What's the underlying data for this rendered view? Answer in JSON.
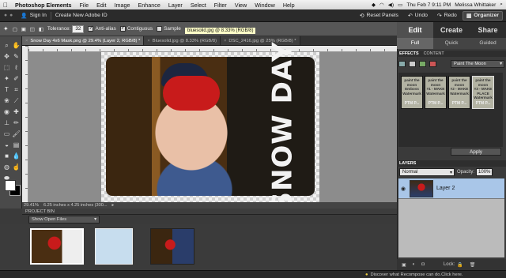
{
  "menubar": {
    "apple": "",
    "items": [
      "Photoshop Elements",
      "File",
      "Edit",
      "Image",
      "Enhance",
      "Layer",
      "Select",
      "Filter",
      "View",
      "Window",
      "Help"
    ],
    "datetime": "Thu Feb 7  9:11 PM",
    "user": "Melissa Whittaker"
  },
  "appbar": {
    "sign_in": "Sign In",
    "create_id": "Create New Adobe ID",
    "reset_panels": "Reset Panels",
    "undo": "Undo",
    "redo": "Redo",
    "organizer": "Organizer"
  },
  "options": {
    "tolerance_label": "Tolerance:",
    "tolerance_value": "32",
    "anti_alias": "Anti-alias",
    "contiguous": "Contiguous",
    "sample": "Sample",
    "tooltip": "bluesolid.jpg @ 8.33% (RGB/8)"
  },
  "doc_tabs": [
    {
      "label": "Snow Day 4x6 Mask.png @ 29.4% (Layer 2, RGB/8) *",
      "active": true
    },
    {
      "label": "Bluesolid.jpg @ 8.33% (RGB/8)",
      "active": false
    },
    {
      "label": "DSC_2416.jpg @ 25% (RGB/8) *",
      "active": false
    }
  ],
  "canvas": {
    "overlay_text": "SNOW DAY"
  },
  "status": {
    "zoom": "29.41%",
    "size": "6.25 inches x 4.25 inches (300..."
  },
  "bin": {
    "title": "PROJECT BIN",
    "select": "Show Open Files"
  },
  "panel": {
    "mode_tabs": [
      "Edit",
      "Create",
      "Share"
    ],
    "sub_tabs": [
      "Full",
      "Quick",
      "Guided"
    ],
    "effects_tab": "EFFECTS",
    "content_tab": "CONTENT",
    "effects_select": "Paint The Moon",
    "effects": [
      {
        "top": "paint the moon",
        "label": "Emboss Watermark",
        "wm": "PTM P..."
      },
      {
        "top": "paint the moon",
        "label": "#1 - MAKE Watermark",
        "wm": "PTM P..."
      },
      {
        "top": "paint the moon",
        "label": "#2 - MAKE Watermark",
        "wm": "PTM P..."
      },
      {
        "top": "paint the moon",
        "label": "#3 - MAKE PLACE Watermark",
        "wm": "PTM P..."
      }
    ],
    "apply": "Apply",
    "layers_title": "LAYERS",
    "blend_mode": "Normal",
    "opacity_label": "Opacity:",
    "opacity_value": "100%",
    "layer_name": "Layer 2",
    "lock_label": "Lock:"
  },
  "bottom": {
    "message": "Discover what Recompose can do.Click here."
  },
  "colors": {
    "accent": "#a9c6e8",
    "hat": "#c81b1b"
  }
}
